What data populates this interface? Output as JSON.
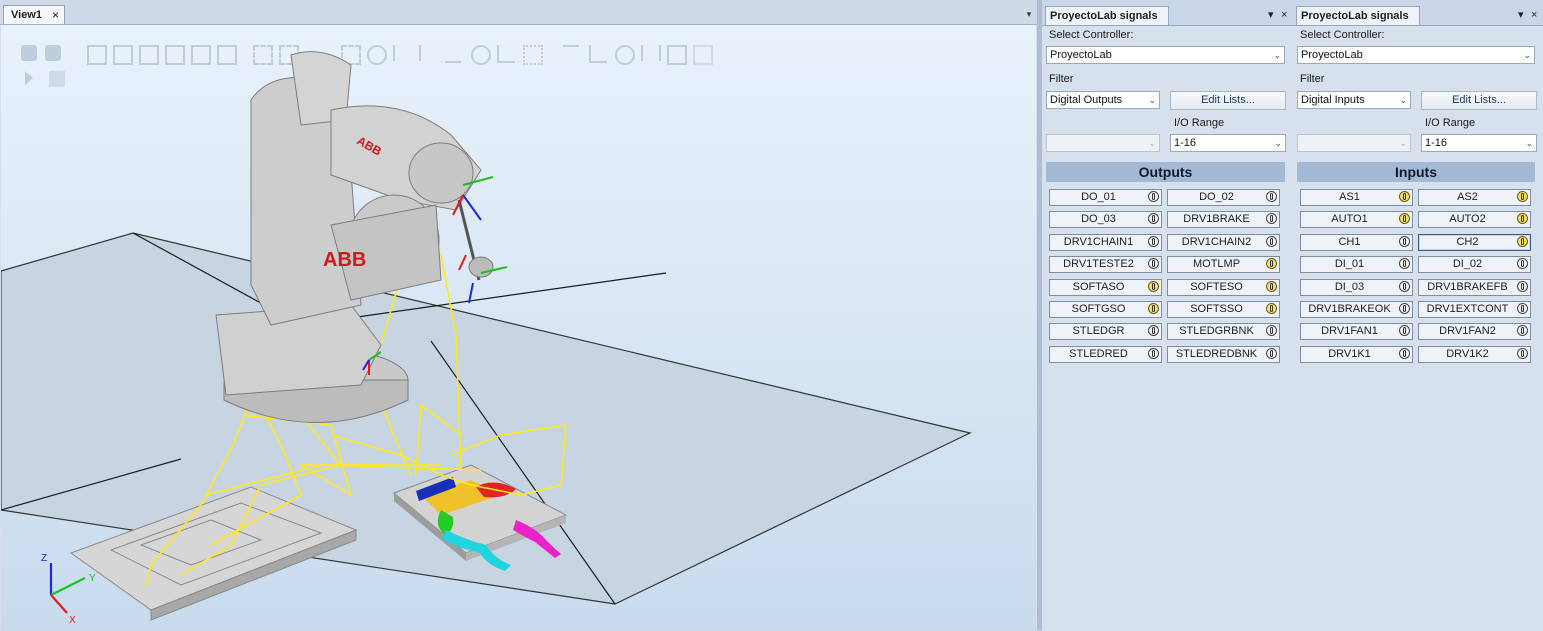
{
  "view": {
    "tab_label": "View1",
    "close_glyph": "×",
    "menu_glyph": "▾",
    "robot_logo": "ABB",
    "axis_labels": {
      "x": "X",
      "y": "Y",
      "z": "Z"
    }
  },
  "panels": [
    {
      "tab_label": "ProyectoLab signals",
      "select_controller_label": "Select Controller:",
      "controller_value": "ProyectoLab",
      "filter_label": "Filter",
      "filter_value": "Digital Outputs",
      "edit_lists_label": "Edit Lists...",
      "io_range_label": "I/O Range",
      "io_range_value": "1-16",
      "section_title": "Outputs",
      "signals": [
        {
          "name": "DO_01",
          "state": "off"
        },
        {
          "name": "DO_02",
          "state": "off"
        },
        {
          "name": "DO_03",
          "state": "off"
        },
        {
          "name": "DRV1BRAKE",
          "state": "off"
        },
        {
          "name": "DRV1CHAIN1",
          "state": "off"
        },
        {
          "name": "DRV1CHAIN2",
          "state": "off"
        },
        {
          "name": "DRV1TESTE2",
          "state": "off"
        },
        {
          "name": "MOTLMP",
          "state": "on"
        },
        {
          "name": "SOFTASO",
          "state": "on"
        },
        {
          "name": "SOFTESO",
          "state": "on"
        },
        {
          "name": "SOFTGSO",
          "state": "on"
        },
        {
          "name": "SOFTSSO",
          "state": "on"
        },
        {
          "name": "STLEDGR",
          "state": "off"
        },
        {
          "name": "STLEDGRBNK",
          "state": "off"
        },
        {
          "name": "STLEDRED",
          "state": "off"
        },
        {
          "name": "STLEDREDBNK",
          "state": "off"
        }
      ]
    },
    {
      "tab_label": "ProyectoLab signals",
      "select_controller_label": "Select Controller:",
      "controller_value": "ProyectoLab",
      "filter_label": "Filter",
      "filter_value": "Digital Inputs",
      "edit_lists_label": "Edit Lists...",
      "io_range_label": "I/O Range",
      "io_range_value": "1-16",
      "section_title": "Inputs",
      "signals": [
        {
          "name": "AS1",
          "state": "on"
        },
        {
          "name": "AS2",
          "state": "on"
        },
        {
          "name": "AUTO1",
          "state": "on"
        },
        {
          "name": "AUTO2",
          "state": "on"
        },
        {
          "name": "CH1",
          "state": "off"
        },
        {
          "name": "CH2",
          "state": "on"
        },
        {
          "name": "DI_01",
          "state": "off"
        },
        {
          "name": "DI_02",
          "state": "off"
        },
        {
          "name": "DI_03",
          "state": "off"
        },
        {
          "name": "DRV1BRAKEFB",
          "state": "off"
        },
        {
          "name": "DRV1BRAKEOK",
          "state": "off"
        },
        {
          "name": "DRV1EXTCONT",
          "state": "off"
        },
        {
          "name": "DRV1FAN1",
          "state": "off"
        },
        {
          "name": "DRV1FAN2",
          "state": "off"
        },
        {
          "name": "DRV1K1",
          "state": "off"
        },
        {
          "name": "DRV1K2",
          "state": "off"
        }
      ]
    }
  ]
}
